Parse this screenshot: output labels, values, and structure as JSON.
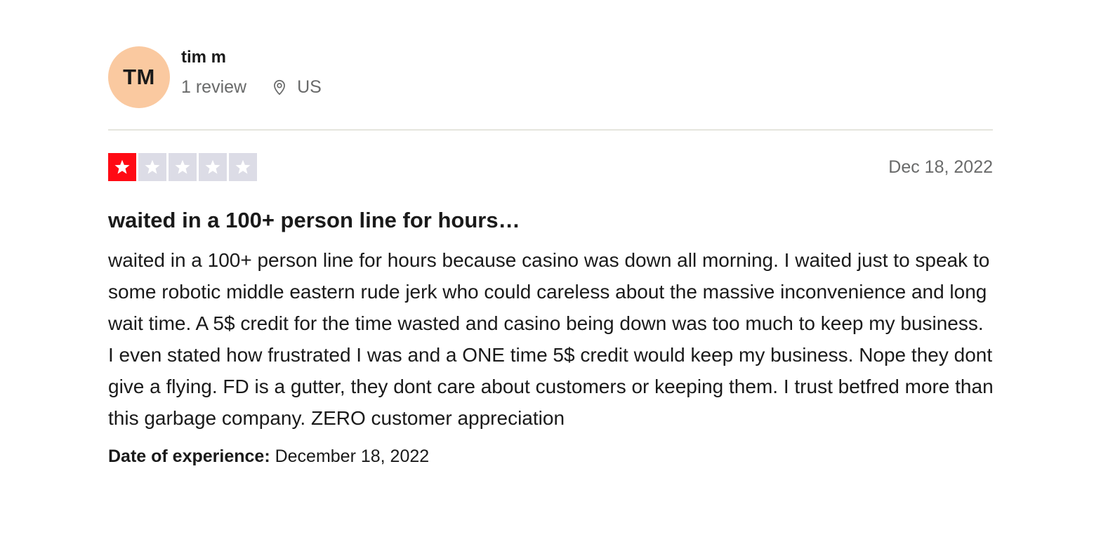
{
  "consumer": {
    "initials": "TM",
    "name": "tim m",
    "review_count": "1 review",
    "country": "US",
    "location_icon": "location-pin-icon",
    "avatar_color": "#fac9a0"
  },
  "review": {
    "rating": 1,
    "rating_max": 5,
    "date": "Dec 18, 2022",
    "title": "waited in a 100+ person line for hours…",
    "body": "waited in a 100+ person line for hours because casino was down all morning. I waited just to speak to some robotic middle eastern rude jerk who could careless about the massive inconvenience and long wait time. A 5$ credit for the time wasted and casino being down was too much to keep my business. I even stated how frustrated I was and a ONE time 5$ credit would keep my business. Nope they dont give a flying. FD is a gutter, they dont care about customers or keeping them. I trust betfred more than this garbage company. ZERO customer appreciation",
    "experience_label": "Date of experience:",
    "experience_date": "December 18, 2022"
  },
  "colors": {
    "star_filled": "#ff0a14",
    "star_empty": "#dcdce6",
    "muted_text": "#696a6a",
    "divider": "#e5e5dd"
  }
}
